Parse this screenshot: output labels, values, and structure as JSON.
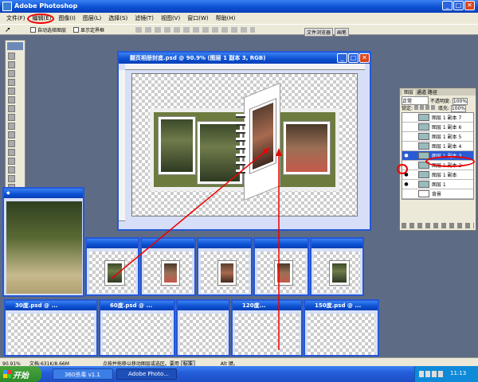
{
  "app": {
    "title": "Adobe Photoshop"
  },
  "menu": [
    "文件(F)",
    "编辑(E)",
    "图像(I)",
    "图层(L)",
    "选择(S)",
    "滤镜(T)",
    "视图(V)",
    "窗口(W)",
    "帮助(H)"
  ],
  "options": {
    "auto_select": "自动选择图层",
    "show_bounds": "显示定界框",
    "tabs": [
      "文件浏览器",
      "画笔"
    ]
  },
  "doc": {
    "title": "翻页相册封底.psd @ 90.9% (图层 1 副本 3, RGB)"
  },
  "layers": {
    "tabs": [
      "图层",
      "通道",
      "路径"
    ],
    "blend": "正常",
    "opacity_label": "不透明度:",
    "opacity": "100%",
    "lock_label": "锁定:",
    "fill_label": "填充:",
    "fill": "100%",
    "items": [
      "图层 1 副本 7",
      "图层 1 副本 6",
      "图层 1 副本 5",
      "图层 1 副本 4",
      "图层 1 副本 3",
      "图层 1 副本 2",
      "图层 1 副本",
      "图层 1",
      "背景"
    ],
    "selected": 4
  },
  "frames": [
    "30度.psd @ ...",
    "60度.psd @ ...",
    "",
    "120度...",
    "150度.psd @ ..."
  ],
  "status": {
    "zoom": "90.91%",
    "doc": "文档:631K/8.66M",
    "hint": "点按并拖移以移动图层或选区。要用",
    "blend": "标准",
    "extra": "Alt 键。"
  },
  "taskbar": {
    "start": "开始",
    "items": [
      "360杀毒 v1.1",
      "Adobe Photo..."
    ],
    "clock": "11:13"
  }
}
